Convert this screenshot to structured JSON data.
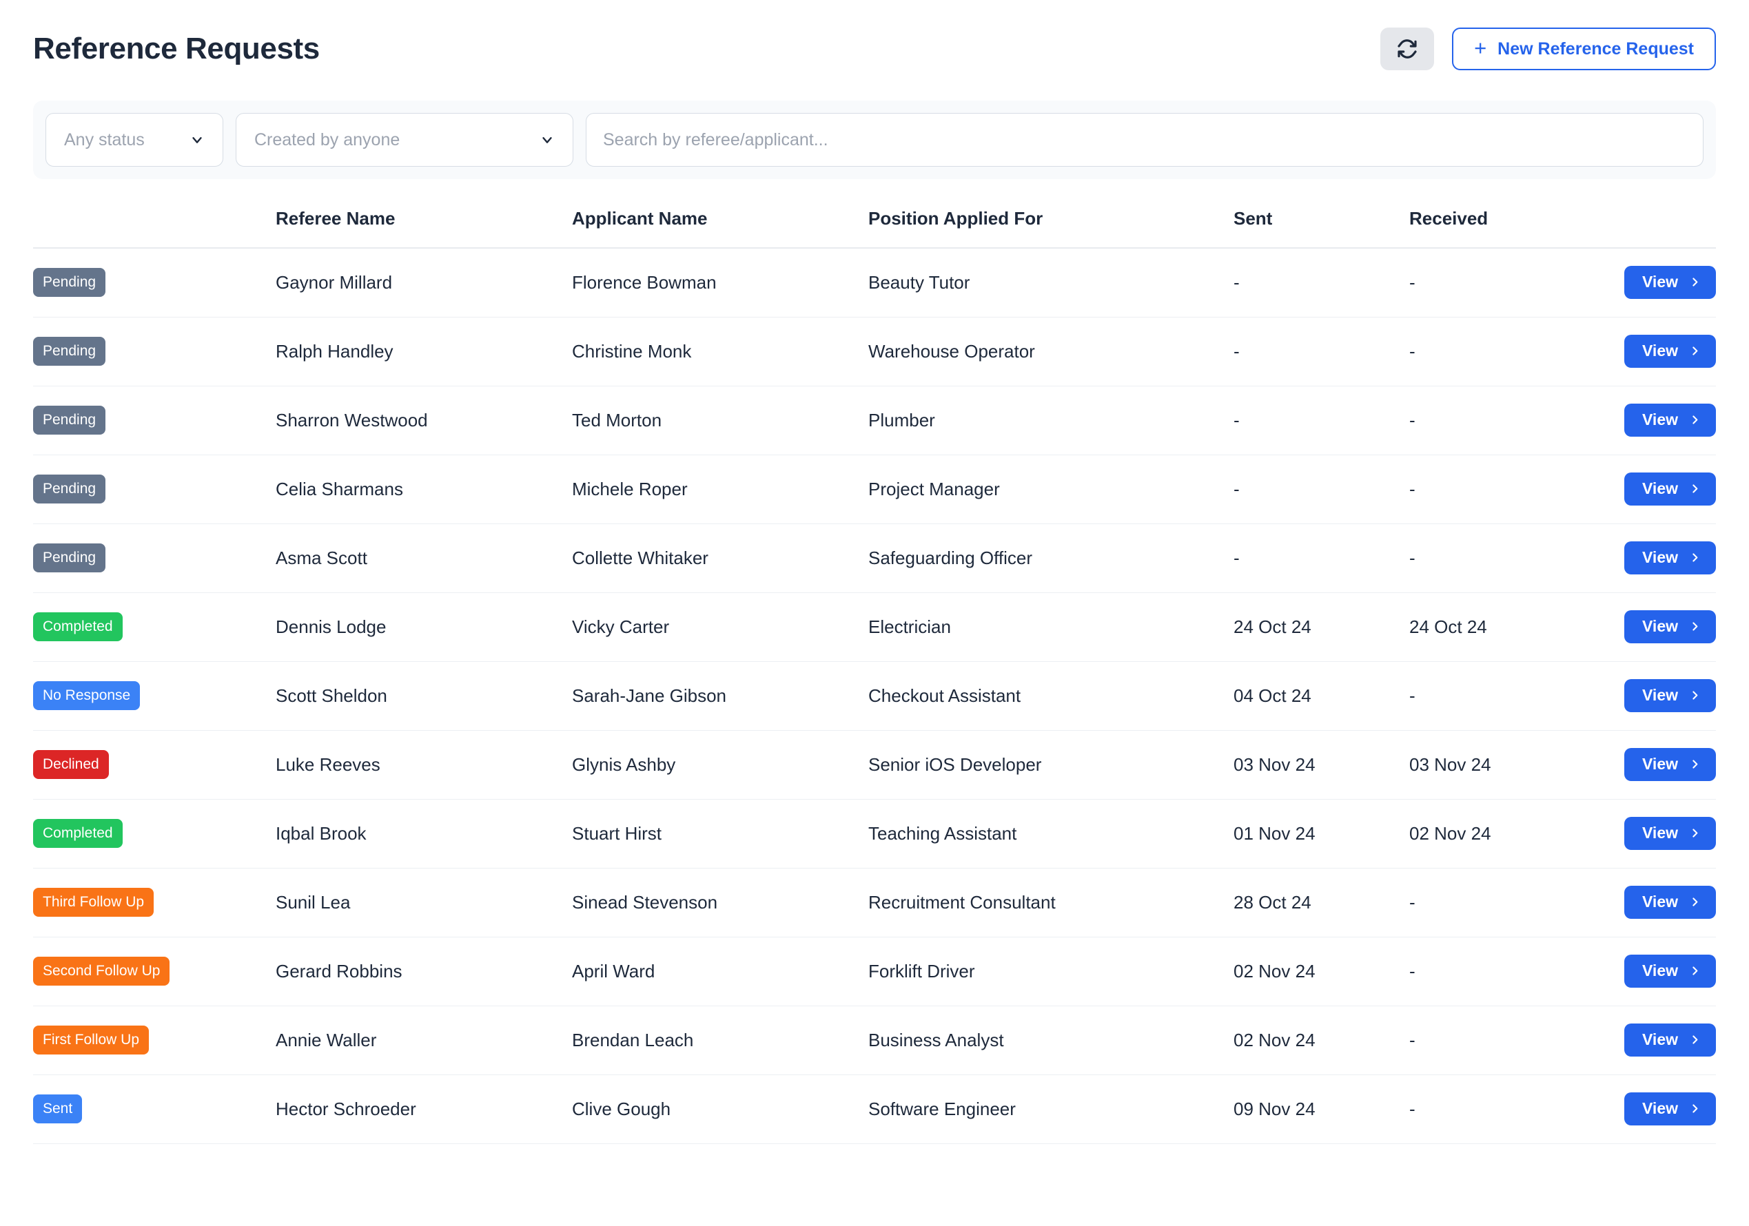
{
  "header": {
    "title": "Reference Requests",
    "refresh_icon": "refresh-icon",
    "new_request_label": "New Reference Request",
    "plus_glyph": "+"
  },
  "filters": {
    "status_value": "Any status",
    "creator_value": "Created by anyone",
    "search_placeholder": "Search by referee/applicant...",
    "search_value": ""
  },
  "table": {
    "columns": {
      "status": "",
      "referee": "Referee Name",
      "applicant": "Applicant Name",
      "position": "Position Applied For",
      "sent": "Sent",
      "received": "Received",
      "action": ""
    },
    "view_label": "View",
    "rows": [
      {
        "status": "Pending",
        "status_class": "badge-pending",
        "referee": "Gaynor Millard",
        "applicant": "Florence Bowman",
        "position": "Beauty Tutor",
        "sent": "-",
        "received": "-"
      },
      {
        "status": "Pending",
        "status_class": "badge-pending",
        "referee": "Ralph Handley",
        "applicant": "Christine Monk",
        "position": "Warehouse Operator",
        "sent": "-",
        "received": "-"
      },
      {
        "status": "Pending",
        "status_class": "badge-pending",
        "referee": "Sharron Westwood",
        "applicant": "Ted Morton",
        "position": "Plumber",
        "sent": "-",
        "received": "-"
      },
      {
        "status": "Pending",
        "status_class": "badge-pending",
        "referee": "Celia Sharmans",
        "applicant": "Michele Roper",
        "position": "Project Manager",
        "sent": "-",
        "received": "-"
      },
      {
        "status": "Pending",
        "status_class": "badge-pending",
        "referee": "Asma Scott",
        "applicant": "Collette Whitaker",
        "position": "Safeguarding Officer",
        "sent": "-",
        "received": "-"
      },
      {
        "status": "Completed",
        "status_class": "badge-completed",
        "referee": "Dennis Lodge",
        "applicant": "Vicky Carter",
        "position": "Electrician",
        "sent": "24 Oct 24",
        "received": "24 Oct 24"
      },
      {
        "status": "No Response",
        "status_class": "badge-noresp",
        "referee": "Scott Sheldon",
        "applicant": "Sarah-Jane Gibson",
        "position": "Checkout Assistant",
        "sent": "04 Oct 24",
        "received": "-"
      },
      {
        "status": "Declined",
        "status_class": "badge-declined",
        "referee": "Luke Reeves",
        "applicant": "Glynis Ashby",
        "position": "Senior iOS Developer",
        "sent": "03 Nov 24",
        "received": "03 Nov 24"
      },
      {
        "status": "Completed",
        "status_class": "badge-completed",
        "referee": "Iqbal Brook",
        "applicant": "Stuart Hirst",
        "position": "Teaching Assistant",
        "sent": "01 Nov 24",
        "received": "02 Nov 24"
      },
      {
        "status": "Third Follow Up",
        "status_class": "badge-followup",
        "referee": "Sunil Lea",
        "applicant": "Sinead Stevenson",
        "position": "Recruitment Consultant",
        "sent": "28 Oct 24",
        "received": "-"
      },
      {
        "status": "Second Follow Up",
        "status_class": "badge-followup",
        "referee": "Gerard Robbins",
        "applicant": "April Ward",
        "position": "Forklift Driver",
        "sent": "02 Nov 24",
        "received": "-"
      },
      {
        "status": "First Follow Up",
        "status_class": "badge-followup",
        "referee": "Annie Waller",
        "applicant": "Brendan Leach",
        "position": "Business Analyst",
        "sent": "02 Nov 24",
        "received": "-"
      },
      {
        "status": "Sent",
        "status_class": "badge-sent",
        "referee": "Hector Schroeder",
        "applicant": "Clive Gough",
        "position": "Software Engineer",
        "sent": "09 Nov 24",
        "received": "-"
      }
    ]
  },
  "colors": {
    "accent": "#2563eb",
    "pending": "#64748b",
    "completed": "#22c55e",
    "no_response": "#3b82f6",
    "declined": "#dc2626",
    "follow_up": "#f97316",
    "sent": "#3b82f6"
  }
}
